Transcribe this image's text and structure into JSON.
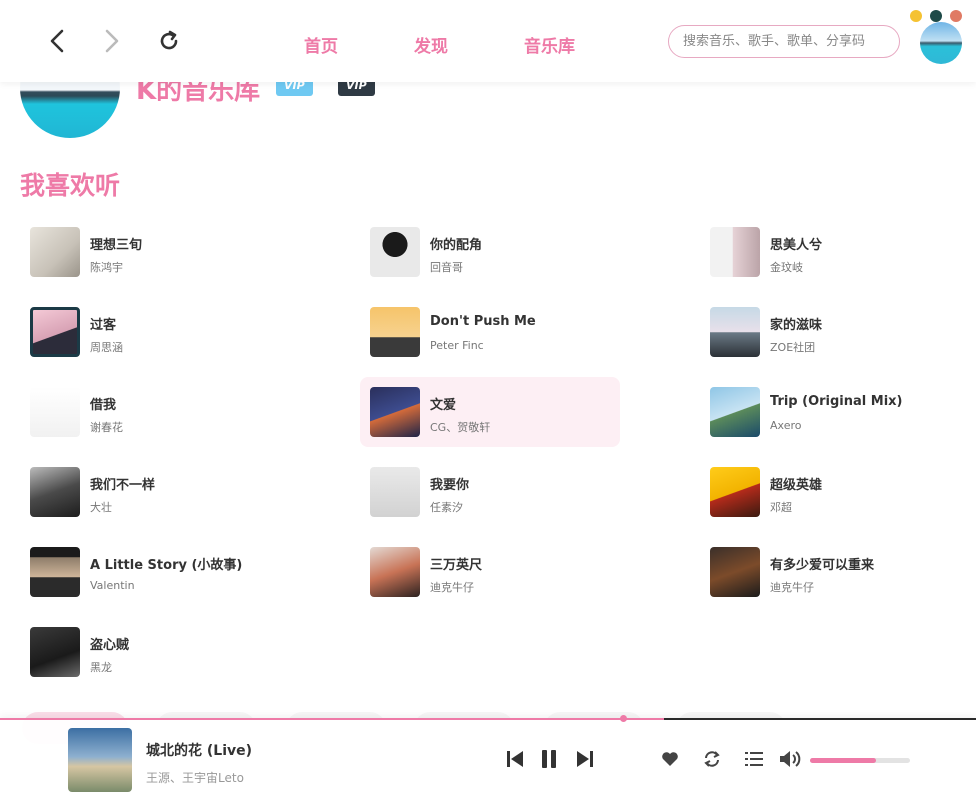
{
  "nav": {
    "home": "首页",
    "discover": "发现",
    "library": "音乐库",
    "search_placeholder": "搜索音乐、歌手、歌单、分享码"
  },
  "window_controls": {
    "minimize_color": "#f5c232",
    "maximize_color": "#1e4a48",
    "close_color": "#e07a64"
  },
  "profile": {
    "name": "K的音乐库",
    "badges": [
      "VIP",
      "VIP"
    ]
  },
  "section": {
    "title": "我喜欢听"
  },
  "songs": [
    {
      "title": "理想三旬",
      "artist": "陈鸿宇"
    },
    {
      "title": "你的配角",
      "artist": "回音哥"
    },
    {
      "title": "思美人兮",
      "artist": "金玟岐"
    },
    {
      "title": "过客",
      "artist": "周思涵"
    },
    {
      "title": "Don't Push Me",
      "artist": "Peter Finc"
    },
    {
      "title": "家的滋味",
      "artist": "ZOE社团"
    },
    {
      "title": "借我",
      "artist": "谢春花"
    },
    {
      "title": "文爱",
      "artist": "CG、贺敬轩"
    },
    {
      "title": "Trip (Original Mix)",
      "artist": "Axero"
    },
    {
      "title": "我们不一样",
      "artist": "大壮"
    },
    {
      "title": "我要你",
      "artist": "任素汐"
    },
    {
      "title": "超级英雄",
      "artist": "邓超"
    },
    {
      "title": "A Little Story (小故事)",
      "artist": "Valentin"
    },
    {
      "title": "三万英尺",
      "artist": "迪克牛仔"
    },
    {
      "title": "有多少爱可以重来",
      "artist": "迪克牛仔"
    },
    {
      "title": "盗心贼",
      "artist": "黑龙"
    }
  ],
  "player": {
    "title": "城北的花 (Live)",
    "artist": "王源、王宇宙Leto",
    "progress": 0.68,
    "volume": 0.66
  },
  "accent_color": "#ee7aa7"
}
